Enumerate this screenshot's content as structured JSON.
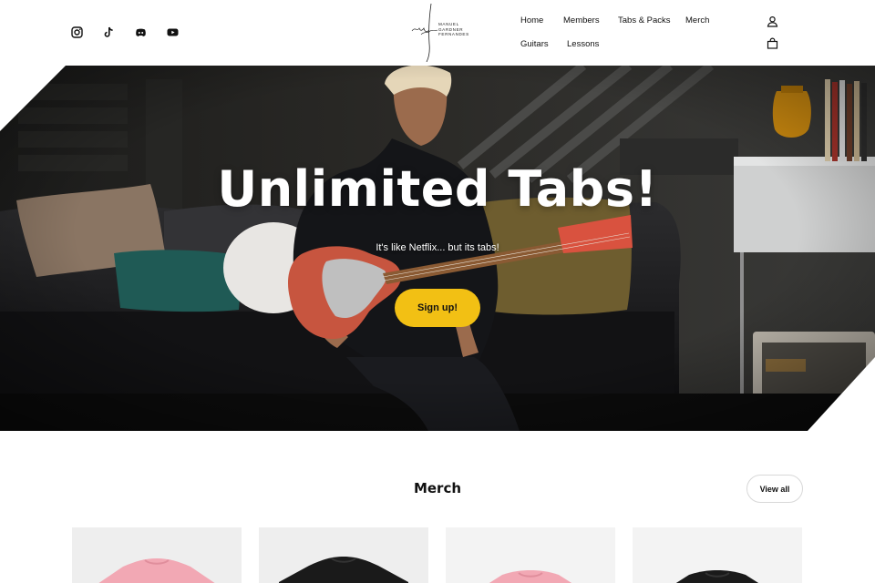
{
  "header": {
    "socials": [
      {
        "name": "instagram-icon"
      },
      {
        "name": "tiktok-icon"
      },
      {
        "name": "discord-icon"
      },
      {
        "name": "youtube-icon"
      }
    ],
    "logo_text": [
      "MANUEL",
      "GARDNER",
      "FERNANDES"
    ],
    "nav": {
      "home": "Home",
      "members": "Members",
      "tabs_packs": "Tabs & Packs",
      "merch": "Merch",
      "guitars": "Guitars",
      "lessons": "Lessons"
    },
    "icons": {
      "account": "user-icon",
      "cart": "bag-icon"
    }
  },
  "hero": {
    "title": "Unlimited Tabs!",
    "subtitle": "It's like Netflix... but its tabs!",
    "cta": "Sign up!"
  },
  "merch": {
    "title": "Merch",
    "view_all": "View all",
    "products": [
      {
        "color": "#f2a8b4"
      },
      {
        "color": "#1a1a1a"
      },
      {
        "color": "#f2a8b4"
      },
      {
        "color": "#1a1a1a"
      }
    ]
  },
  "colors": {
    "accent": "#f2c014",
    "hero_bg": "#171614"
  }
}
